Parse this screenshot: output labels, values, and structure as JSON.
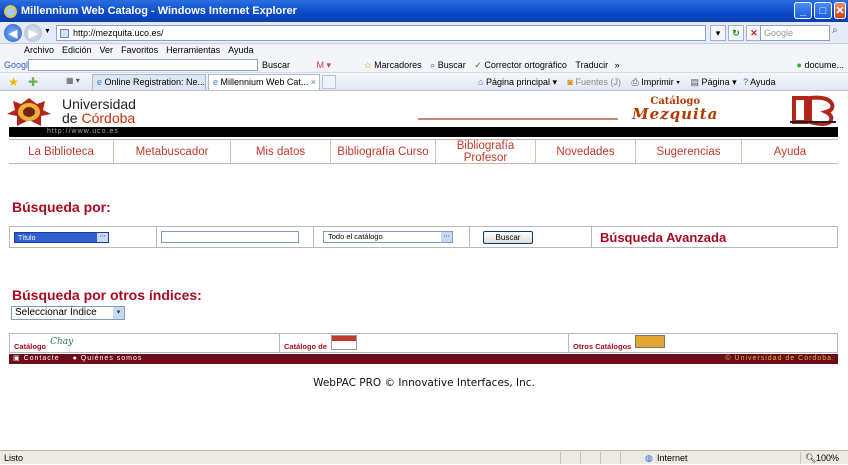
{
  "window": {
    "title": "Millennium Web Catalog - Windows Internet Explorer"
  },
  "address_bar": {
    "url": "http://mezquita.uco.es/",
    "search_placeholder": "Google"
  },
  "menu": [
    "Archivo",
    "Edición",
    "Ver",
    "Favoritos",
    "Herramientas",
    "Ayuda"
  ],
  "google_toolbar": {
    "label": "Google",
    "buscar": "Buscar",
    "marcadores": "Marcadores",
    "buscar2": "Buscar",
    "corrector": "Corrector ortográfico",
    "traducir": "Traducir",
    "right": "docume..."
  },
  "tabs": [
    "Online Registration: Ne...",
    "Millennium Web Cat..."
  ],
  "tab_tools": {
    "home": "Página principal",
    "feeds": "Fuentes (J)",
    "print": "Imprimir",
    "page": "Página",
    "help": "Ayuda"
  },
  "header": {
    "uni_line1": "Universidad",
    "uni_line2a": "de ",
    "uni_line2b": "Córdoba",
    "catalogo_top": "Catálogo",
    "catalogo_bottom": "Mezquita",
    "url": "http://www.uco.es"
  },
  "nav": [
    {
      "label": "La Biblioteca"
    },
    {
      "label": "Metabuscador"
    },
    {
      "label": "Mis datos"
    },
    {
      "label": "Bibliografía Curso"
    },
    {
      "label": "Bibliografía Profesor"
    },
    {
      "label": "Novedades"
    },
    {
      "label": "Sugerencias"
    },
    {
      "label": "Ayuda"
    }
  ],
  "search": {
    "heading": "Búsqueda por:",
    "field_selected": "Título",
    "query_value": "",
    "scope_selected": "Todo el catálogo",
    "button": "Buscar",
    "advanced": "Búsqueda Avanzada"
  },
  "other_indexes": {
    "heading": "Búsqueda por otros índices:",
    "select": "Seleccionar Índice"
  },
  "catalogs": {
    "c1": "Catálogo",
    "c1_logo": "Chay",
    "c2": "Catálogo de",
    "c3": "Otros Catálogos"
  },
  "footer": {
    "contact": "Contacte",
    "about": "Quiénes somos",
    "uni": "© Universidad de Córdoba",
    "webpac": "WebPAC PRO © Innovative Interfaces, Inc."
  },
  "status": {
    "text": "Listo",
    "zone": "Internet",
    "zoom": "100%"
  }
}
